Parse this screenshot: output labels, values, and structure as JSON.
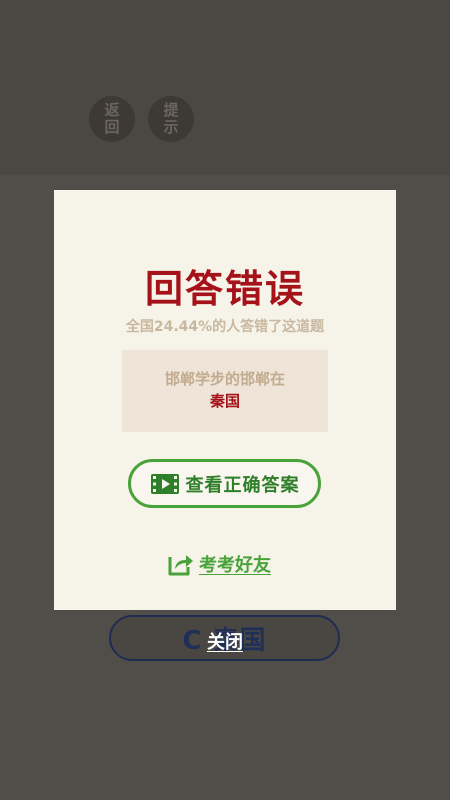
{
  "background": {
    "back_button": "返回",
    "hint_button": "提示",
    "option_label": "C 秦国"
  },
  "modal": {
    "title": "回答错误",
    "subtitle": "全国24.44%的人答错了这道题",
    "question": "邯郸学步的邯郸在",
    "answer": "秦国",
    "view_answer_label": "查看正确答案",
    "view_answer_icon": "video-icon",
    "share_label": "考考好友",
    "share_icon": "share-icon"
  },
  "close_label": "关闭",
  "colors": {
    "error_red": "#a5121a",
    "green": "#4aa23a",
    "modal_bg": "#f6f3e9",
    "overlay": "#4f4b47"
  }
}
